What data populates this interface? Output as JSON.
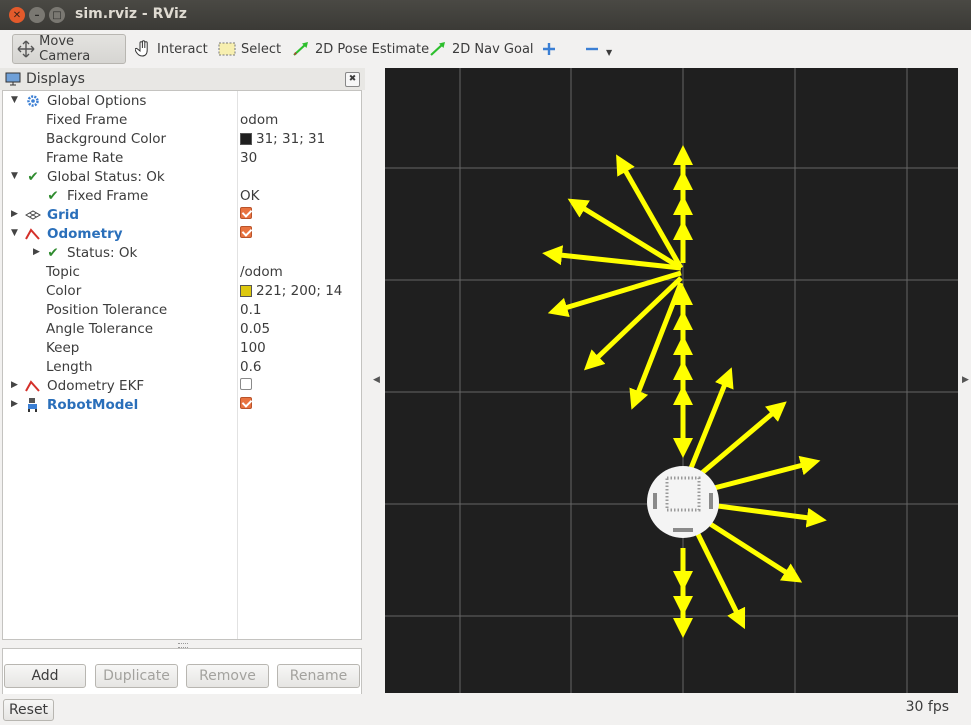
{
  "window": {
    "title": "sim.rviz - RViz"
  },
  "toolbar": {
    "move_camera": "Move Camera",
    "interact": "Interact",
    "select": "Select",
    "pose_estimate": "2D Pose Estimate",
    "nav_goal": "2D Nav Goal"
  },
  "displays": {
    "title": "Displays",
    "rows": {
      "global_options": "Global Options",
      "fixed_frame": {
        "label": "Fixed Frame",
        "value": "odom"
      },
      "background_color": {
        "label": "Background Color",
        "value": "31; 31; 31",
        "color": "#1f1f1f"
      },
      "frame_rate": {
        "label": "Frame Rate",
        "value": "30"
      },
      "global_status": "Global Status: Ok",
      "status_fixed_frame": {
        "label": "Fixed Frame",
        "value": "OK"
      },
      "grid": "Grid",
      "odometry": "Odometry",
      "odom_status": "Status: Ok",
      "topic": {
        "label": "Topic",
        "value": "/odom"
      },
      "color": {
        "label": "Color",
        "value": "221; 200; 14",
        "color": "#ddc80e"
      },
      "position_tolerance": {
        "label": "Position Tolerance",
        "value": "0.1"
      },
      "angle_tolerance": {
        "label": "Angle Tolerance",
        "value": "0.05"
      },
      "keep": {
        "label": "Keep",
        "value": "100"
      },
      "length": {
        "label": "Length",
        "value": "0.6"
      },
      "odometry_ekf": "Odometry EKF",
      "robot_model": "RobotModel"
    },
    "checkboxes": {
      "grid": true,
      "odometry": true,
      "odometry_ekf": false,
      "robot_model": true
    }
  },
  "buttons": {
    "add": "Add",
    "duplicate": "Duplicate",
    "remove": "Remove",
    "rename": "Rename"
  },
  "status": {
    "reset": "Reset",
    "fps": "30 fps"
  },
  "colors": {
    "accent_orange": "#e9733f",
    "arrow_yellow": "#ffff00",
    "grid": "#a0a0a0"
  }
}
